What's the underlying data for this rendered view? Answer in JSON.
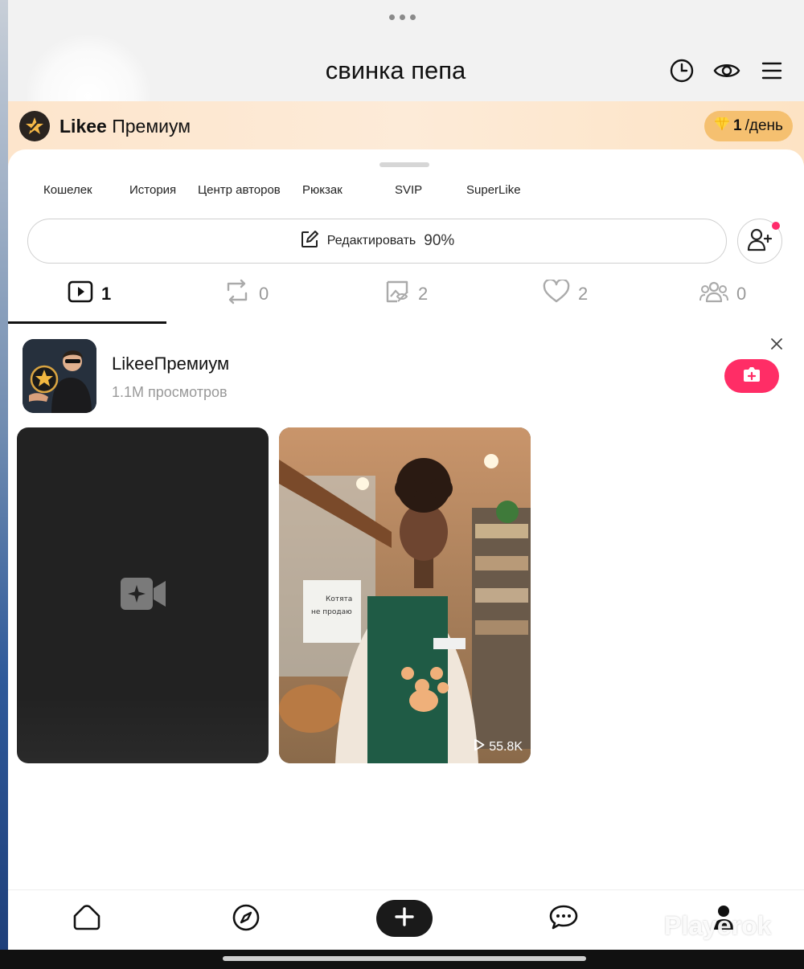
{
  "header": {
    "title": "свинка пепа",
    "icons": [
      "history-icon",
      "eye-icon",
      "menu-icon"
    ]
  },
  "premium_banner": {
    "brand": "Likee",
    "product": "Премиум",
    "badge_count": "1",
    "badge_unit": "/день",
    "icon": "diamond-icon"
  },
  "quick_links": [
    "Кошелек",
    "История",
    "Центр авторов",
    "Рюкзак",
    "SVIP",
    "SuperLike"
  ],
  "edit_profile": {
    "label": "Редактировать",
    "percent": "90%"
  },
  "tabs": [
    {
      "icon": "video-icon",
      "count": "1",
      "active": true
    },
    {
      "icon": "repost-icon",
      "count": "0",
      "active": false
    },
    {
      "icon": "private-icon",
      "count": "2",
      "active": false
    },
    {
      "icon": "heart-icon",
      "count": "2",
      "active": false
    },
    {
      "icon": "group-icon",
      "count": "0",
      "active": false
    }
  ],
  "promo": {
    "name": "LikeeПремиум",
    "views": "1.1M просмотров"
  },
  "videos": [
    {
      "type": "create",
      "icon": "add-video-icon"
    },
    {
      "type": "video",
      "views": "55.8K",
      "sign_text": "Котята не продаю"
    }
  ],
  "bottom_nav": {
    "items": [
      "home-icon",
      "explore-icon",
      "plus-icon",
      "messages-icon",
      "profile-icon"
    ],
    "watermark": "Playerok"
  },
  "colors": {
    "accent": "#ff2d66",
    "premium_bg": "#fde5cc",
    "diamond_pill": "#f5c070"
  }
}
